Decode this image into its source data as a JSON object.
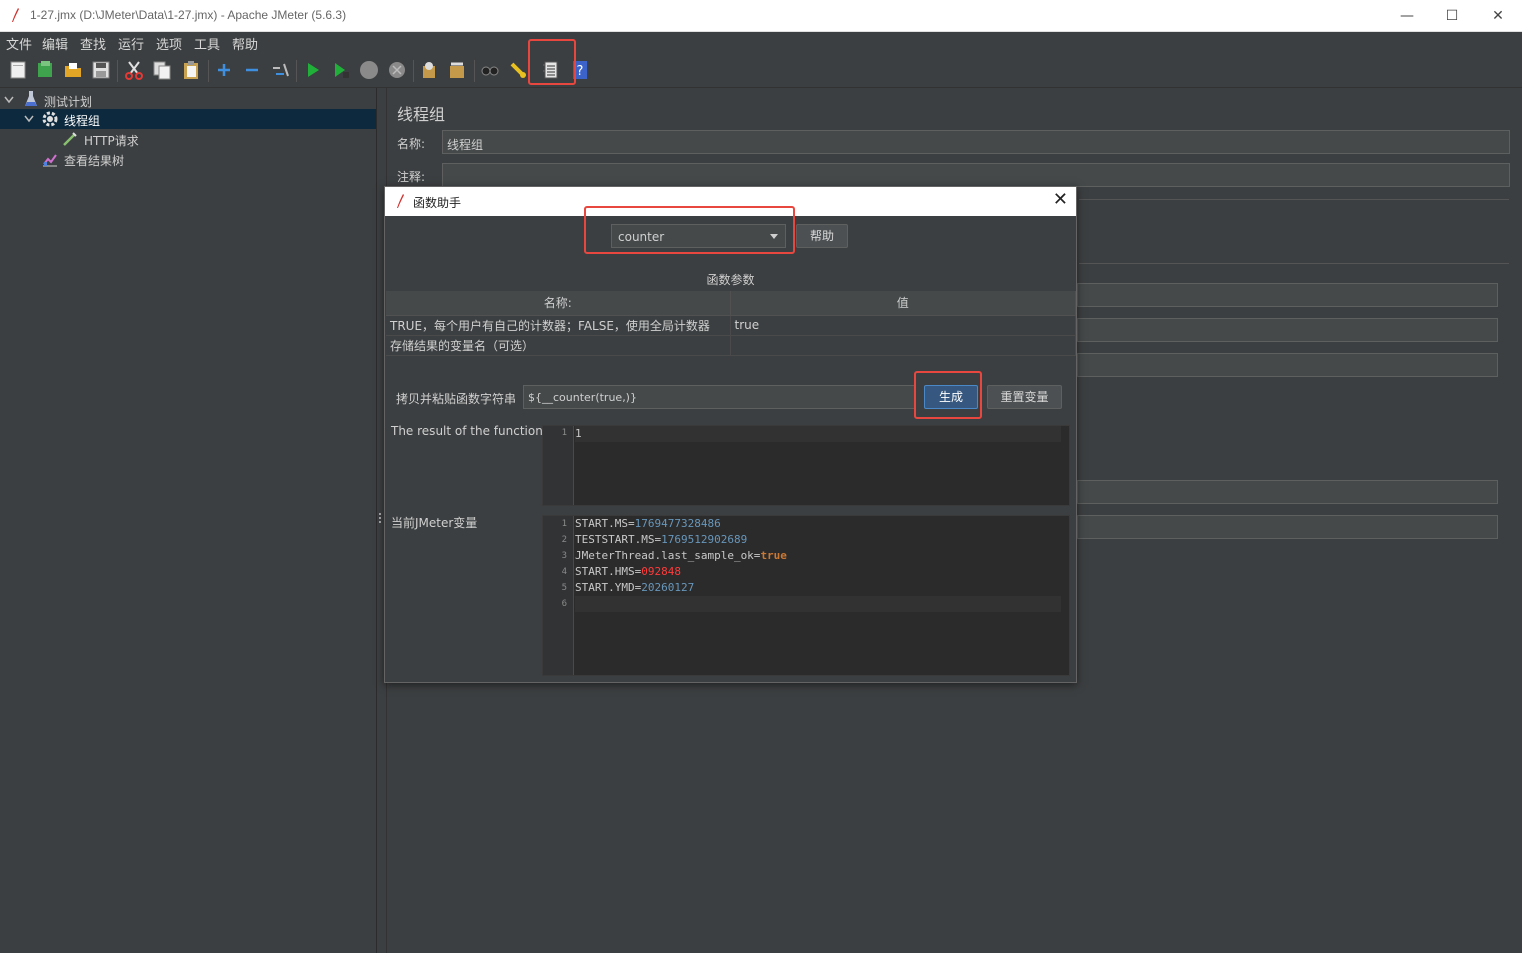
{
  "window": {
    "title": "1-27.jmx (D:\\JMeter\\Data\\1-27.jmx) - Apache JMeter (5.6.3)",
    "minimize": "—",
    "maximize": "☐",
    "close": "✕"
  },
  "menu": [
    "文件",
    "编辑",
    "查找",
    "运行",
    "选项",
    "工具",
    "帮助"
  ],
  "tree": {
    "test_plan": "测试计划",
    "thread_group": "线程组",
    "http_request": "HTTP请求",
    "result_tree": "查看结果树"
  },
  "right_panel": {
    "title": "线程组",
    "name_label": "名称:",
    "name_value": "线程组",
    "comment_label": "注释:"
  },
  "dialog": {
    "title": "函数助手",
    "function_selected": "counter",
    "help_button": "帮助",
    "params_heading": "函数参数",
    "table": {
      "headers": [
        "名称:",
        "值"
      ],
      "rows": [
        [
          "TRUE，每个用户有自己的计数器；FALSE，使用全局计数器",
          "true"
        ],
        [
          "存储结果的变量名（可选）",
          ""
        ]
      ]
    },
    "copy_label": "拷贝并粘贴函数字符串",
    "function_string": "${__counter(true,)}",
    "generate_button": "生成",
    "reset_button": "重置变量",
    "result_label": "The result of the function is",
    "result_lines": [
      "1"
    ],
    "vars_label": "当前JMeter变量",
    "vars": [
      {
        "key": "START.MS=",
        "value": "1769477328486",
        "type": "num"
      },
      {
        "key": "TESTSTART.MS=",
        "value": "1769512902689",
        "type": "num"
      },
      {
        "key": "JMeterThread.last_sample_ok=",
        "value": "true",
        "type": "kw"
      },
      {
        "key": "START.HMS=",
        "value": "092848",
        "type": "red"
      },
      {
        "key": "START.YMD=",
        "value": "20260127",
        "type": "num"
      },
      {
        "key": "",
        "value": "",
        "type": "plain"
      }
    ]
  },
  "colors": {
    "highlight": "#e8473f",
    "background": "#3c3f41",
    "editor_bg": "#2b2b2b",
    "number": "#6897bb",
    "keyword": "#cc7832",
    "selected_node": "#0d293e"
  },
  "icons": [
    "new-icon",
    "templates-icon",
    "open-icon",
    "save-icon",
    "cut-icon",
    "copy-icon",
    "paste-icon",
    "expand-icon",
    "collapse-icon",
    "toggle-icon",
    "start-icon",
    "start-no-pause-icon",
    "stop-icon",
    "shutdown-icon",
    "clear-icon",
    "clear-all-icon",
    "search-icon",
    "reset-search-icon",
    "function-helper-icon",
    "help-icon"
  ]
}
